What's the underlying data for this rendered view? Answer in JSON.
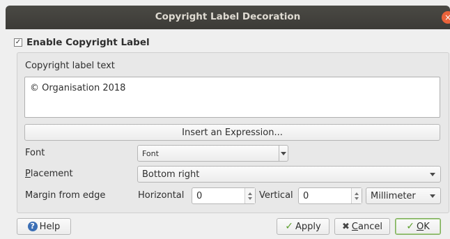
{
  "window": {
    "title": "Copyright Label Decoration"
  },
  "enable": {
    "checked_mark": "✓",
    "label": "Enable Copyright Label"
  },
  "labels": {
    "text_label": "Copyright label text",
    "font": "Font",
    "placement_first": "P",
    "placement_rest": "lacement",
    "margin": "Margin from edge",
    "horizontal": "Horizontal",
    "vertical": "Vertical"
  },
  "text_value": "© Organisation 2018",
  "insert_expression": "Insert an Expression...",
  "font_button": "Font",
  "placement_value": "Bottom right",
  "horizontal_value": "0",
  "vertical_value": "0",
  "units_value": "Millimeter",
  "buttons": {
    "help": "Help",
    "apply": "Apply",
    "cancel_first": "C",
    "cancel_rest": "ancel",
    "ok_first": "O",
    "ok_rest": "K"
  },
  "icons": {
    "help": "help-icon",
    "apply": "check-icon",
    "cancel": "x-icon",
    "ok": "check-icon",
    "close": "close-icon"
  }
}
